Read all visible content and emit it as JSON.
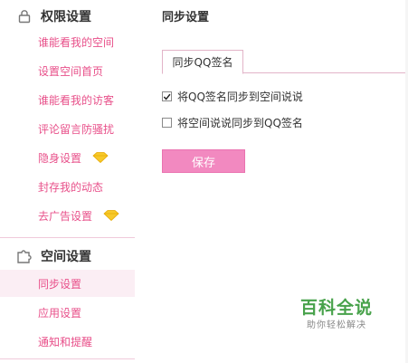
{
  "sidebar": {
    "permissions": {
      "title": "权限设置",
      "icon": "lock-icon",
      "items": [
        {
          "label": "谁能看我的空间"
        },
        {
          "label": "设置空间首页"
        },
        {
          "label": "谁能看我的访客"
        },
        {
          "label": "评论留言防骚扰"
        },
        {
          "label": "隐身设置",
          "icon": "gem-icon"
        },
        {
          "label": "封存我的动态"
        },
        {
          "label": "去广告设置",
          "icon": "gem-icon"
        }
      ]
    },
    "space": {
      "title": "空间设置",
      "icon": "puzzle-icon",
      "items": [
        {
          "label": "同步设置",
          "active": true
        },
        {
          "label": "应用设置"
        },
        {
          "label": "通知和提醒"
        }
      ]
    }
  },
  "main": {
    "title": "同步设置",
    "tab": "同步QQ签名",
    "options": [
      {
        "label": "将QQ签名同步到空间说说",
        "checked": true
      },
      {
        "label": "将空间说说同步到QQ签名",
        "checked": false
      }
    ],
    "save_label": "保存"
  },
  "watermark": {
    "title": "百科全说",
    "subtitle": "助你轻松解决"
  },
  "colors": {
    "accent": "#e8508a",
    "button": "#f289c0",
    "active_bg": "#fbeef4",
    "watermark": "#48a24b"
  }
}
